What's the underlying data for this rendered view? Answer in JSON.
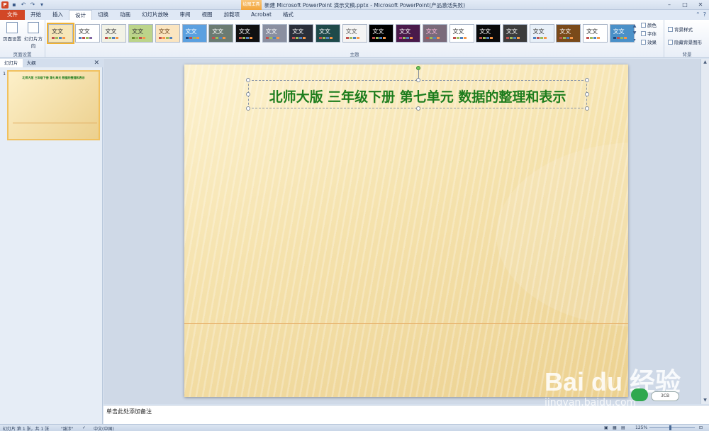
{
  "titlebar": {
    "context_tab": "绘图工具",
    "title": "新建 Microsoft PowerPoint 演示文稿.pptx - Microsoft PowerPoint(产品激活失败)"
  },
  "tabs": [
    "文件",
    "开始",
    "插入",
    "设计",
    "切换",
    "动画",
    "幻灯片放映",
    "审阅",
    "视图",
    "加载项",
    "Acrobat",
    "格式"
  ],
  "active_tab": "设计",
  "ribbon": {
    "page_setup": {
      "btn1": "页面设置",
      "btn2": "幻灯片方向",
      "group": "页面设置"
    },
    "theme_group": "主题",
    "theme_sample": "文文",
    "theme_options": {
      "colors": "颜色",
      "fonts": "字体",
      "effects": "效果"
    },
    "background": {
      "styles": "背景样式",
      "hide": "隐藏背景图形",
      "group": "背景"
    }
  },
  "pane": {
    "tab_slides": "幻灯片",
    "tab_outline": "大纲",
    "slide_num": "1"
  },
  "slide": {
    "title": "北师大版  三年级下册  第七单元  数据的整理和表示"
  },
  "notes": {
    "placeholder": "单击此处添加备注"
  },
  "status": {
    "slide_info": "幻灯片 第 1 张，共 1 张",
    "theme": "\"跋涉\"",
    "language": "中文(中国)",
    "zoom": "125%"
  },
  "watermark": {
    "text": "Bai du 经验",
    "sub": "jingyan.baidu.com",
    "badge": "3CB"
  },
  "colors": {
    "accent": "#d24726",
    "title_green": "#1d7d1d"
  }
}
